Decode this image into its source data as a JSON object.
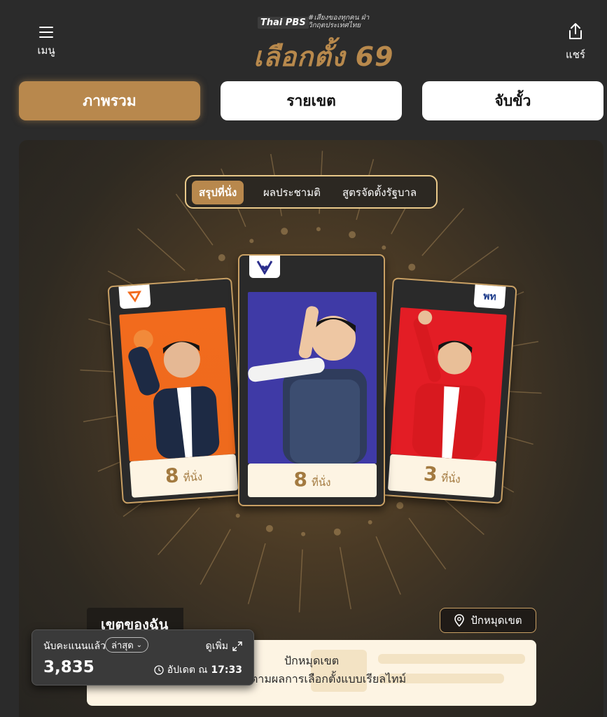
{
  "header": {
    "menu_label": "เมนู",
    "share_label": "แชร์",
    "logo": {
      "brand": "Thai PBS",
      "tagline": "#เสียงของทุกคน ฝ่าวิกฤตประเทศไทย",
      "title": "เลือกตั้ง 69"
    }
  },
  "main_tabs": [
    {
      "label": "ภาพรวม",
      "active": true
    },
    {
      "label": "รายเขต",
      "active": false
    },
    {
      "label": "จับขั้ว",
      "active": false
    }
  ],
  "sub_tabs": [
    {
      "label": "สรุปที่นั่ง",
      "active": true
    },
    {
      "label": "ผลประชามติ",
      "active": false
    },
    {
      "label": "สูตรจัดตั้งรัฐบาล",
      "active": false
    }
  ],
  "cards": {
    "left": {
      "party_logo": "พรรคประชาชน logo",
      "seats": "8",
      "seat_unit": "ที่นั่ง",
      "photo_color": "#f26b1d"
    },
    "center": {
      "party_logo": "ภูมิใจไทย logo",
      "seats": "8",
      "seat_unit": "ที่นั่ง",
      "photo_color": "#3f3aa6"
    },
    "right": {
      "party_logo": "พท",
      "seats": "3",
      "seat_unit": "ที่นั่ง",
      "photo_color": "#e31d25"
    }
  },
  "district": {
    "title": "เขตของฉัน",
    "pin_button": "ปักหมุดเขต",
    "line1": "ปักหมุดเขต",
    "line2": "ตามผลการเลือกตั้งแบบเรียลไทม์"
  },
  "count_widget": {
    "label": "นับคะแนนแล้ว",
    "badge": "ล่าสุด",
    "more": "ดูเพิ่ม",
    "count": "3,835",
    "update_prefix": "อัปเดต ณ",
    "update_time": "17:33"
  }
}
